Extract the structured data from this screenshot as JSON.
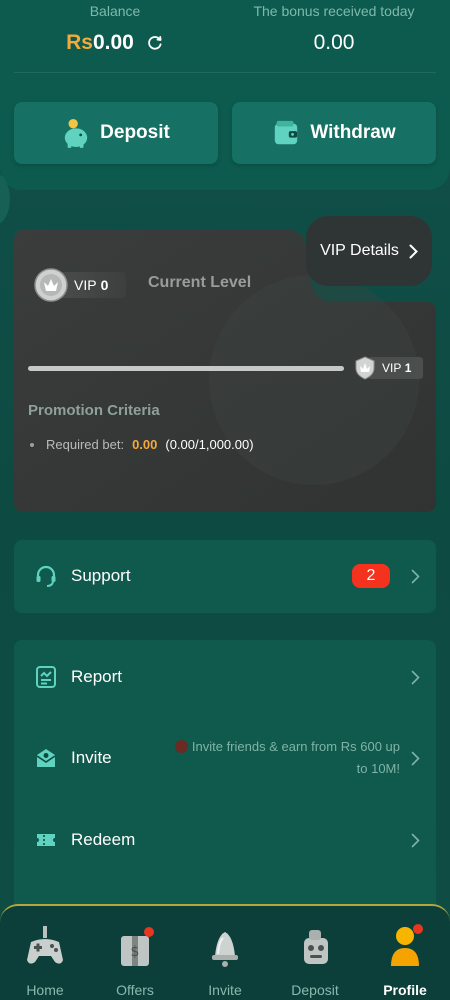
{
  "balance": {
    "label": "Balance",
    "currency": "Rs",
    "amount": "0.00"
  },
  "bonus": {
    "label": "The bonus received today",
    "amount": "0.00"
  },
  "actions": {
    "deposit_label": "Deposit",
    "withdraw_label": "Withdraw"
  },
  "vip": {
    "details_label": "VIP Details",
    "current_vip_prefix": "VIP",
    "current_vip_level": "0",
    "current_level_label": "Current Level",
    "next_vip_prefix": "VIP",
    "next_vip_level": "1",
    "progress_fraction": 0,
    "promotion_title": "Promotion Criteria",
    "required_bet_label": "Required bet:",
    "required_bet_value": "0.00",
    "required_bet_progress": "(0.00/1,000.00)"
  },
  "menu": {
    "support_label": "Support",
    "support_badge": "2",
    "report_label": "Report",
    "invite_label": "Invite",
    "invite_note_line1": "Invite friends & earn from Rs 600 up",
    "invite_note_line2": "to 10M!",
    "redeem_label": "Redeem"
  },
  "nav": {
    "items": [
      {
        "label": "Home",
        "icon": "gamepad-icon"
      },
      {
        "label": "Offers",
        "icon": "gift-icon"
      },
      {
        "label": "Invite",
        "icon": "bell-icon"
      },
      {
        "label": "Deposit",
        "icon": "wallet-robot-icon"
      },
      {
        "label": "Profile",
        "icon": "profile-icon"
      }
    ],
    "active": "Profile"
  },
  "colors": {
    "accent_gold": "#f5a93b",
    "badge_red": "#f4321e",
    "background": "#0f4a41"
  }
}
